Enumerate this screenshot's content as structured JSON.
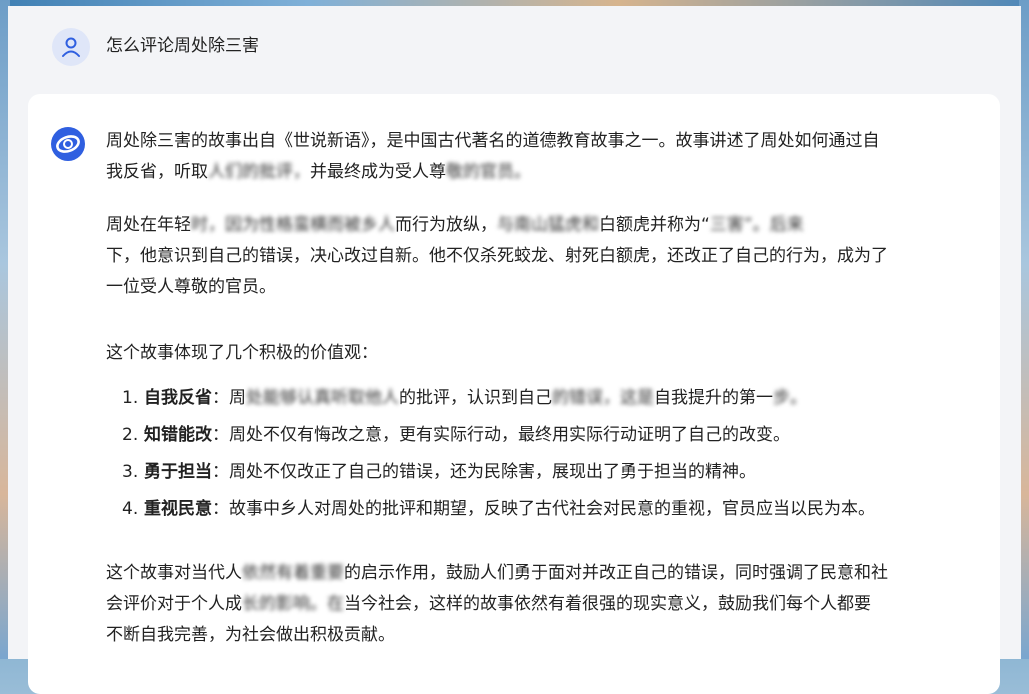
{
  "user": {
    "question": "怎么评论周处除三害"
  },
  "answer": {
    "p1_a": "周处除三害的故事出自《世说新语》，是中国古代著名的道德教育故事之一。故事讲述了周处如何通过自",
    "p1_b": "我反省，听取",
    "p1_blur1": "人们的批评，",
    "p1_c": "并最终成为受人尊",
    "p1_blur2": "敬的官员。",
    "p2_a": "周处在年轻",
    "p2_blur1": "时，因为性格蛮横而被乡人",
    "p2_b": "而行为放纵，",
    "p2_blur2": "与南山猛虎和",
    "p2_c": "白额虎并称为“",
    "p2_blur3": "三害”。后来",
    "p2_d": "下，他意识到自己的错误，决心改过自新。他不仅杀死蛟龙、射死白额虎，还改正了自己的行为，成为了",
    "p2_e": "一位受人尊敬的官员。",
    "p3": "这个故事体现了几个积极的价值观：",
    "items": [
      {
        "num": "1.",
        "term": "自我反省",
        "text_a": "：周",
        "text_blur": "处能够认真听取他人",
        "text_b": "的批评，认识到自己",
        "text_blur2": "的错误，这是",
        "text_c": "自我提升的第一",
        "text_blur3": "步。"
      },
      {
        "num": "2.",
        "term": "知错能改",
        "text_a": "：周处不仅有悔改之意，更有实际行动，最终用实际行动证明了自己的改变。",
        "text_blur": "",
        "text_b": "",
        "text_blur2": "",
        "text_c": "",
        "text_blur3": ""
      },
      {
        "num": "3.",
        "term": "勇于担当",
        "text_a": "：周处不仅改正了自己的错误，还为民除害，展现出了勇于担当的精神。",
        "text_blur": "",
        "text_b": "",
        "text_blur2": "",
        "text_c": "",
        "text_blur3": ""
      },
      {
        "num": "4.",
        "term": "重视民意",
        "text_a": "：故事中乡人对周处的批评和期望，反映了古代社会对民意的重视，官员应当以民为本。",
        "text_blur": "",
        "text_b": "",
        "text_blur2": "",
        "text_c": "",
        "text_blur3": ""
      }
    ],
    "p5_a": "这个故事对当代人",
    "p5_blur1": "依然有着重要",
    "p5_b": "的启示作用，鼓励人们勇于面对并改正自己的错误，同时强调了民意和社",
    "p5_c": "会评价对于个人成",
    "p5_blur2": "长的影响。在",
    "p5_d": "当今社会，这样的故事依然有着很强的现实意义，鼓励我们每个人都要",
    "p5_e": "不断自我完善，为社会做出积极贡献。"
  },
  "colors": {
    "page_bg": "#f3f4f7",
    "card_bg": "#ffffff",
    "text": "#222222",
    "bot_icon": "#2f5fe0",
    "user_icon": "#2f5fe0"
  }
}
